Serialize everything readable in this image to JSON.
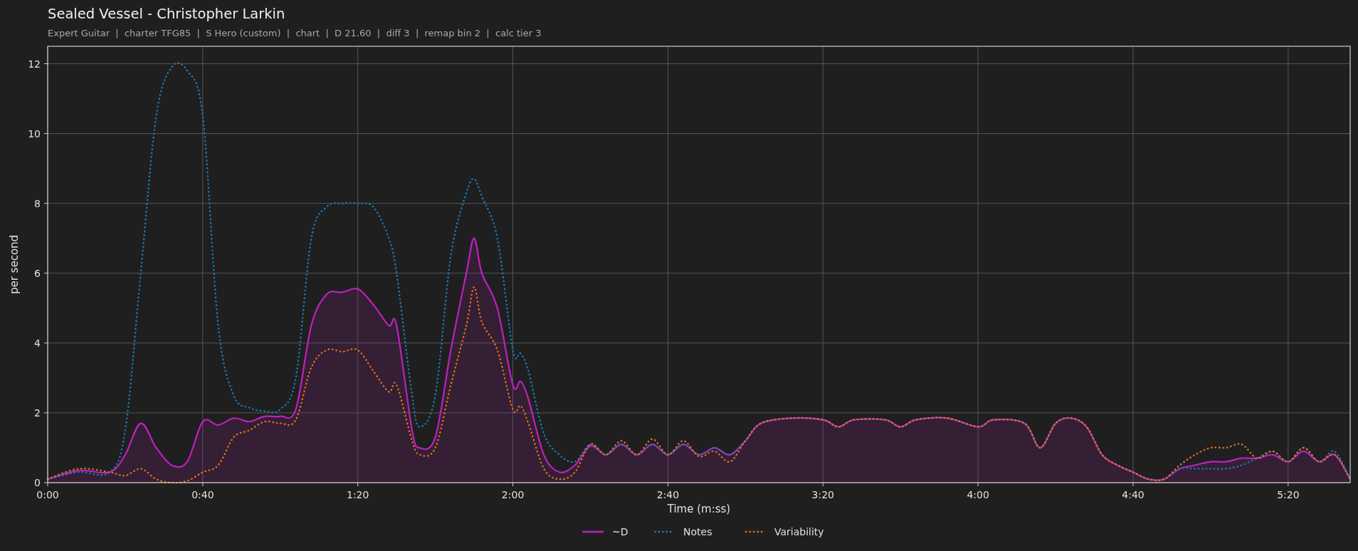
{
  "header": {
    "title": "Sealed Vessel - Christopher Larkin",
    "subtitle": "Expert Guitar  |  charter TFG85  |  S Hero (custom)  |  chart  |  D 21.60  |  diff 3  |  remap bin 2  |  calc tier 3"
  },
  "chart_data": {
    "type": "line",
    "grid": true,
    "legend": true,
    "xlabel": "Time (m:ss)",
    "ylabel": "per second",
    "xlim": [
      0,
      336
    ],
    "ylim": [
      0,
      12.5
    ],
    "xticks": [
      {
        "value": 0,
        "label": "0:00"
      },
      {
        "value": 40,
        "label": "0:40"
      },
      {
        "value": 80,
        "label": "1:20"
      },
      {
        "value": 120,
        "label": "2:00"
      },
      {
        "value": 160,
        "label": "2:40"
      },
      {
        "value": 200,
        "label": "3:20"
      },
      {
        "value": 240,
        "label": "4:00"
      },
      {
        "value": 280,
        "label": "4:40"
      },
      {
        "value": 320,
        "label": "5:20"
      }
    ],
    "yticks": [
      0,
      2,
      4,
      6,
      8,
      10,
      12
    ],
    "x": [
      0,
      8,
      16,
      20,
      24,
      28,
      32,
      36,
      40,
      44,
      48,
      52,
      56,
      60,
      64,
      68,
      72,
      76,
      80,
      84,
      88,
      90,
      94,
      96,
      100,
      104,
      108,
      110,
      112,
      116,
      120,
      122,
      124,
      128,
      132,
      136,
      140,
      144,
      148,
      152,
      156,
      160,
      164,
      168,
      172,
      176,
      180,
      184,
      192,
      200,
      204,
      208,
      216,
      220,
      224,
      232,
      240,
      244,
      252,
      256,
      260,
      264,
      268,
      272,
      276,
      280,
      284,
      288,
      292,
      296,
      300,
      304,
      308,
      312,
      316,
      320,
      324,
      328,
      332,
      336
    ],
    "series": [
      {
        "name": "~D",
        "color": "#c020c0",
        "line_style": "solid",
        "values": [
          0.1,
          0.35,
          0.3,
          0.8,
          1.7,
          1.0,
          0.5,
          0.6,
          1.75,
          1.65,
          1.85,
          1.75,
          1.9,
          1.9,
          2.1,
          4.5,
          5.4,
          5.45,
          5.55,
          5.1,
          4.5,
          4.5,
          1.5,
          1.0,
          1.3,
          3.8,
          6.0,
          7.0,
          6.0,
          5.0,
          2.8,
          2.9,
          2.4,
          0.8,
          0.3,
          0.5,
          1.05,
          0.8,
          1.1,
          0.8,
          1.1,
          0.8,
          1.1,
          0.8,
          1.0,
          0.8,
          1.2,
          1.7,
          1.85,
          1.8,
          1.6,
          1.8,
          1.8,
          1.6,
          1.8,
          1.85,
          1.6,
          1.8,
          1.7,
          1.0,
          1.7,
          1.85,
          1.6,
          0.8,
          0.5,
          0.3,
          0.1,
          0.1,
          0.4,
          0.5,
          0.6,
          0.6,
          0.7,
          0.7,
          0.8,
          0.6,
          0.9,
          0.6,
          0.8,
          0.1
        ]
      },
      {
        "name": "Notes",
        "color": "#1f77b4",
        "line_style": "dotted",
        "values": [
          0.1,
          0.3,
          0.3,
          1.5,
          6,
          10.5,
          11.9,
          11.8,
          10.5,
          4.5,
          2.5,
          2.15,
          2.05,
          2.1,
          3,
          7,
          7.9,
          8.0,
          8.0,
          7.9,
          7,
          6,
          2.5,
          1.6,
          2.5,
          6.5,
          8.3,
          8.7,
          8.2,
          7,
          3.8,
          3.7,
          3.2,
          1.4,
          0.8,
          0.6,
          1.1,
          0.8,
          1.1,
          0.8,
          1.1,
          0.8,
          1.1,
          0.8,
          1.0,
          0.8,
          1.2,
          1.7,
          1.85,
          1.8,
          1.6,
          1.8,
          1.8,
          1.6,
          1.8,
          1.85,
          1.6,
          1.8,
          1.7,
          1.0,
          1.7,
          1.85,
          1.6,
          0.8,
          0.5,
          0.3,
          0.1,
          0.1,
          0.4,
          0.4,
          0.4,
          0.4,
          0.5,
          0.7,
          0.9,
          0.6,
          1.0,
          0.6,
          0.9,
          0.1
        ]
      },
      {
        "name": "Variability",
        "color": "#e0701a",
        "line_style": "dotted",
        "values": [
          0.1,
          0.4,
          0.3,
          0.2,
          0.4,
          0.1,
          0.0,
          0.05,
          0.3,
          0.5,
          1.3,
          1.5,
          1.75,
          1.7,
          1.8,
          3.3,
          3.8,
          3.75,
          3.8,
          3.2,
          2.6,
          2.8,
          1.2,
          0.8,
          1.0,
          2.8,
          4.5,
          5.6,
          4.6,
          3.8,
          2.1,
          2.2,
          1.7,
          0.4,
          0.1,
          0.3,
          1.1,
          0.8,
          1.2,
          0.8,
          1.25,
          0.8,
          1.2,
          0.75,
          0.9,
          0.6,
          1.2,
          1.7,
          1.85,
          1.8,
          1.6,
          1.8,
          1.8,
          1.6,
          1.8,
          1.85,
          1.6,
          1.8,
          1.7,
          1.0,
          1.7,
          1.85,
          1.6,
          0.8,
          0.5,
          0.3,
          0.1,
          0.1,
          0.5,
          0.8,
          1.0,
          1.0,
          1.1,
          0.7,
          0.9,
          0.6,
          1.0,
          0.6,
          0.8,
          0.1
        ]
      }
    ]
  }
}
